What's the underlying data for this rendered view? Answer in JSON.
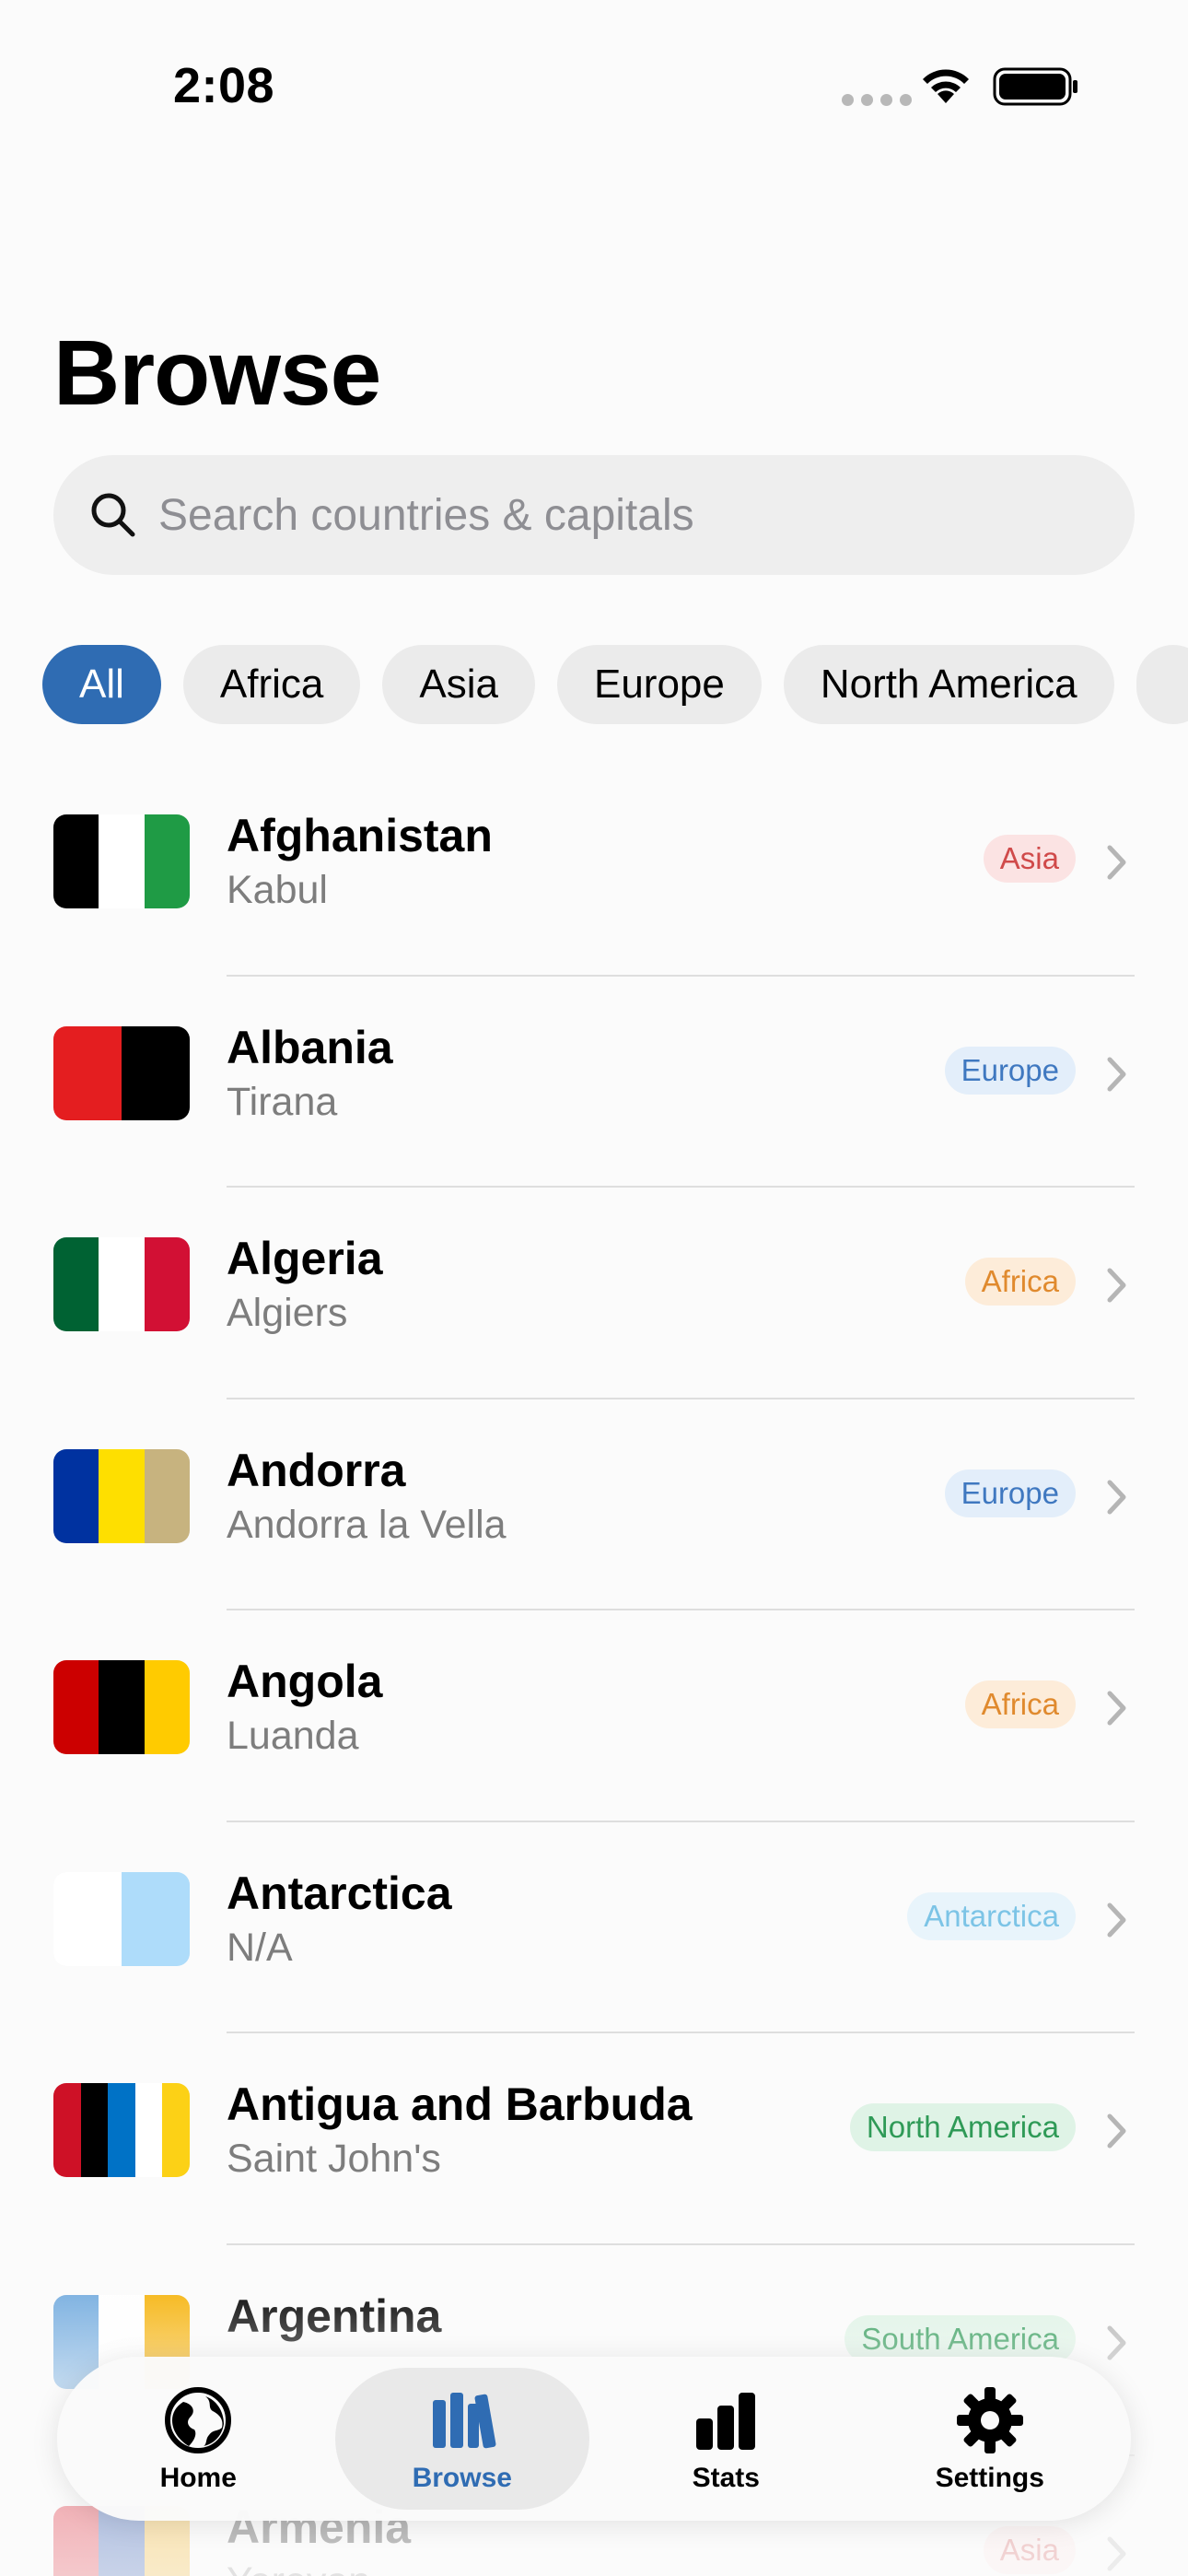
{
  "status_bar": {
    "time": "2:08"
  },
  "title": "Browse",
  "search": {
    "placeholder": "Search countries & capitals",
    "value": ""
  },
  "filters": [
    "All",
    "Africa",
    "Asia",
    "Europe",
    "North America",
    ""
  ],
  "active_filter": "All",
  "region_colors": {
    "Asia": {
      "bg": "#fbe3e3",
      "fg": "#d04a4a"
    },
    "Europe": {
      "bg": "#e3eefa",
      "fg": "#3f78c0"
    },
    "Africa": {
      "bg": "#fdecd9",
      "fg": "#e08a2e"
    },
    "Antarctica": {
      "bg": "#e8f4fb",
      "fg": "#7cc4e6"
    },
    "North America": {
      "bg": "#dff3e6",
      "fg": "#2f9a57"
    },
    "South America": {
      "bg": "#dff3e6",
      "fg": "#2f9a57"
    }
  },
  "countries": [
    {
      "name": "Afghanistan",
      "capital": "Kabul",
      "region": "Asia",
      "flag": [
        "#000000",
        "#ffffff",
        "#1f9b45"
      ]
    },
    {
      "name": "Albania",
      "capital": "Tirana",
      "region": "Europe",
      "flag": [
        "#e41e20",
        "#000000"
      ]
    },
    {
      "name": "Algeria",
      "capital": "Algiers",
      "region": "Africa",
      "flag": [
        "#006233",
        "#ffffff",
        "#d21034"
      ]
    },
    {
      "name": "Andorra",
      "capital": "Andorra la Vella",
      "region": "Europe",
      "flag": [
        "#0032a0",
        "#fedf00",
        "#c7b37f"
      ]
    },
    {
      "name": "Angola",
      "capital": "Luanda",
      "region": "Africa",
      "flag": [
        "#cc0000",
        "#000000",
        "#ffcb00"
      ]
    },
    {
      "name": "Antarctica",
      "capital": "N/A",
      "region": "Antarctica",
      "flag": [
        "#ffffff",
        "#aedcfa"
      ]
    },
    {
      "name": "Antigua and Barbuda",
      "capital": "Saint John's",
      "region": "North America",
      "flag": [
        "#ce1126",
        "#000000",
        "#0072c6",
        "#ffffff",
        "#fcd116"
      ]
    },
    {
      "name": "Argentina",
      "capital": "",
      "region": "South America",
      "flag": [
        "#74acdf",
        "#ffffff",
        "#f6b40e"
      ]
    },
    {
      "name": "Armenia",
      "capital": "Yerevan",
      "region": "Asia",
      "flag": [
        "#d90012",
        "#0033a0",
        "#f2a800"
      ]
    }
  ],
  "tabs": [
    {
      "label": "Home",
      "icon": "globe-icon"
    },
    {
      "label": "Browse",
      "icon": "books-icon"
    },
    {
      "label": "Stats",
      "icon": "bar-chart-icon"
    },
    {
      "label": "Settings",
      "icon": "gear-icon"
    }
  ],
  "active_tab": "Browse"
}
